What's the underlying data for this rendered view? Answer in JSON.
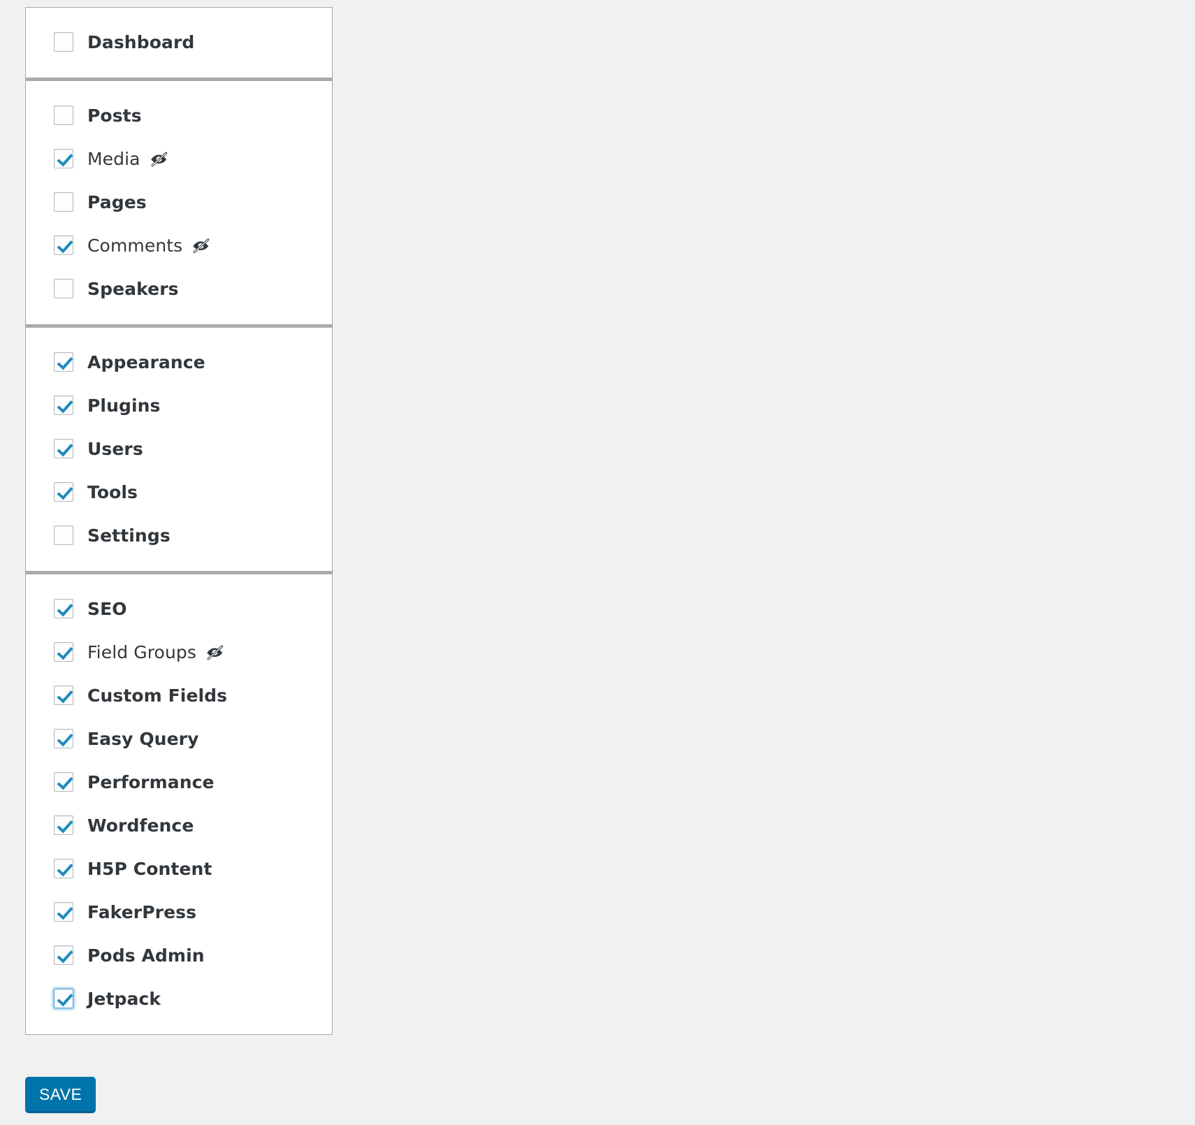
{
  "panel": {
    "sections": [
      {
        "name": "primary",
        "items": [
          {
            "label": "Dashboard",
            "checked": false,
            "hidden_icon": false,
            "bold": true,
            "focused": false
          }
        ]
      },
      {
        "name": "content",
        "items": [
          {
            "label": "Posts",
            "checked": false,
            "hidden_icon": false,
            "bold": true,
            "focused": false
          },
          {
            "label": "Media",
            "checked": true,
            "hidden_icon": true,
            "bold": false,
            "focused": false
          },
          {
            "label": "Pages",
            "checked": false,
            "hidden_icon": false,
            "bold": true,
            "focused": false
          },
          {
            "label": "Comments",
            "checked": true,
            "hidden_icon": true,
            "bold": false,
            "focused": false
          },
          {
            "label": "Speakers",
            "checked": false,
            "hidden_icon": false,
            "bold": true,
            "focused": false
          }
        ]
      },
      {
        "name": "admin",
        "items": [
          {
            "label": "Appearance",
            "checked": true,
            "hidden_icon": false,
            "bold": true,
            "focused": false
          },
          {
            "label": "Plugins",
            "checked": true,
            "hidden_icon": false,
            "bold": true,
            "focused": false
          },
          {
            "label": "Users",
            "checked": true,
            "hidden_icon": false,
            "bold": true,
            "focused": false
          },
          {
            "label": "Tools",
            "checked": true,
            "hidden_icon": false,
            "bold": true,
            "focused": false
          },
          {
            "label": "Settings",
            "checked": false,
            "hidden_icon": false,
            "bold": true,
            "focused": false
          }
        ]
      },
      {
        "name": "plugins",
        "items": [
          {
            "label": "SEO",
            "checked": true,
            "hidden_icon": false,
            "bold": true,
            "focused": false
          },
          {
            "label": "Field Groups",
            "checked": true,
            "hidden_icon": true,
            "bold": false,
            "focused": false
          },
          {
            "label": "Custom Fields",
            "checked": true,
            "hidden_icon": false,
            "bold": true,
            "focused": false
          },
          {
            "label": "Easy Query",
            "checked": true,
            "hidden_icon": false,
            "bold": true,
            "focused": false
          },
          {
            "label": "Performance",
            "checked": true,
            "hidden_icon": false,
            "bold": true,
            "focused": false
          },
          {
            "label": "Wordfence",
            "checked": true,
            "hidden_icon": false,
            "bold": true,
            "focused": false
          },
          {
            "label": "H5P Content",
            "checked": true,
            "hidden_icon": false,
            "bold": true,
            "focused": false
          },
          {
            "label": "FakerPress",
            "checked": true,
            "hidden_icon": false,
            "bold": true,
            "focused": false
          },
          {
            "label": "Pods Admin",
            "checked": true,
            "hidden_icon": false,
            "bold": true,
            "focused": false
          },
          {
            "label": "Jetpack",
            "checked": true,
            "hidden_icon": false,
            "bold": true,
            "focused": true
          }
        ]
      }
    ]
  },
  "footer": {
    "save_label": "SAVE"
  },
  "icons": {
    "hidden": "eye-slash-icon",
    "checkmark": "check-icon"
  },
  "colors": {
    "accent": "#0073aa",
    "checkmark": "#1e8cbe",
    "text": "#32373c",
    "panel_border": "#a9a9a9",
    "divider": "#aaaaaa",
    "page_background": "#f1f1f1",
    "focus_ring": "#5b9dd9"
  }
}
